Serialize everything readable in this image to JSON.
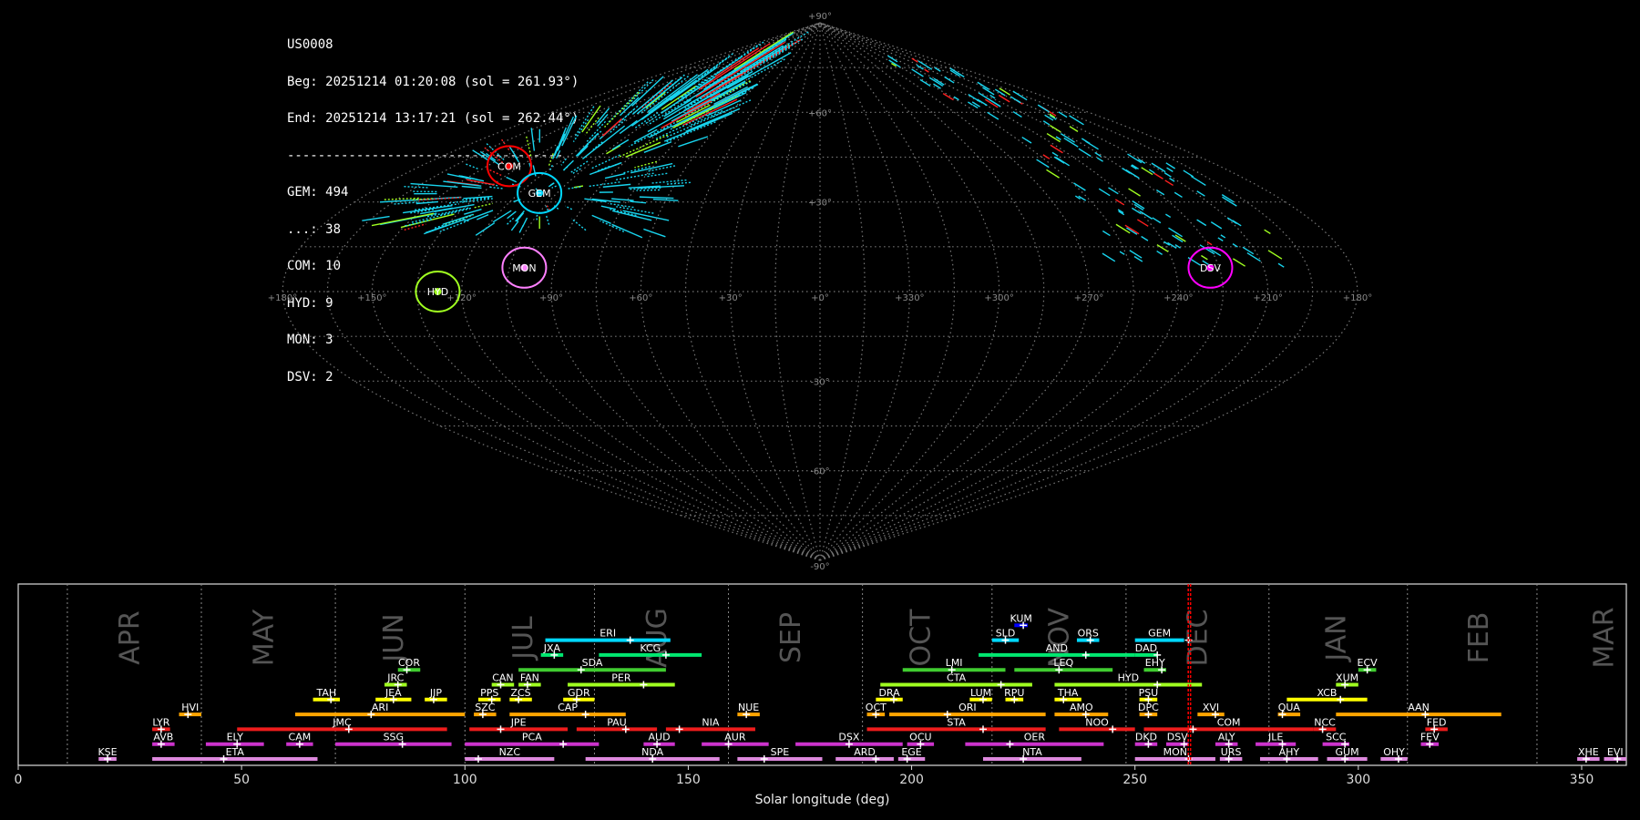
{
  "info": {
    "id": "US0008",
    "beg": "Beg: 20251214 01:20:08 (sol = 261.93°)",
    "end": "End: 20251214 13:17:21 (sol = 262.44°)",
    "sep": "------------------------------------",
    "counts": [
      "GEM: 494",
      "...: 38",
      "COM: 10",
      "HYD: 9",
      "MON: 3",
      "DSV: 2"
    ]
  },
  "sky_map": {
    "projection": "sinusoidal",
    "lat_labels": [
      "+90°",
      "+60°",
      "+30°",
      "-30°",
      "-60°",
      "-90°"
    ],
    "lon_labels": [
      "+180°",
      "+150°",
      "+120°",
      "+90°",
      "+60°",
      "+30°",
      "+0°",
      "+330°",
      "+300°",
      "+270°",
      "+240°",
      "+210°",
      "+180°"
    ],
    "radiants": [
      {
        "name": "COM",
        "lon": 140,
        "lat": 42,
        "color": "#ff0000"
      },
      {
        "name": "GEM",
        "lon": 112,
        "lat": 33,
        "color": "#00d8ff"
      },
      {
        "name": "MON",
        "lon": 100,
        "lat": 8,
        "color": "#ff80ff"
      },
      {
        "name": "HYD",
        "lon": 128,
        "lat": 0,
        "color": "#a0ff20"
      },
      {
        "name": "DSV",
        "lon": 228,
        "lat": 8,
        "color": "#ff00ff"
      }
    ]
  },
  "chart_data": {
    "type": "timeline",
    "xlabel": "Solar longitude (deg)",
    "xlim": [
      0,
      360
    ],
    "xticks": [
      0,
      50,
      100,
      150,
      200,
      250,
      300,
      350
    ],
    "month_boundaries": [
      11,
      41,
      71,
      100,
      129,
      159,
      189,
      218,
      248,
      280,
      311,
      340
    ],
    "months": [
      {
        "name": "APR",
        "x": 25
      },
      {
        "name": "MAY",
        "x": 55
      },
      {
        "name": "JUN",
        "x": 84
      },
      {
        "name": "JUL",
        "x": 113
      },
      {
        "name": "AUG",
        "x": 143
      },
      {
        "name": "SEP",
        "x": 173
      },
      {
        "name": "OCT",
        "x": 202
      },
      {
        "name": "NOV",
        "x": 233
      },
      {
        "name": "DEC",
        "x": 264
      },
      {
        "name": "JAN",
        "x": 295
      },
      {
        "name": "FEB",
        "x": 327
      },
      {
        "name": "MAR",
        "x": 355
      }
    ],
    "current_sol": [
      261.93,
      262.44
    ],
    "showers": [
      {
        "name": "KUM",
        "start": 223,
        "end": 226,
        "peak": 225,
        "row": 10,
        "color": "#0000ff"
      },
      {
        "name": "ERI",
        "start": 118,
        "end": 146,
        "peak": 137,
        "row": 9,
        "color": "#00d8ff"
      },
      {
        "name": "SLD",
        "start": 218,
        "end": 224,
        "peak": 221,
        "row": 9,
        "color": "#00d8ff"
      },
      {
        "name": "ORS",
        "start": 237,
        "end": 242,
        "peak": 240,
        "row": 9,
        "color": "#00d8ff"
      },
      {
        "name": "GEM",
        "start": 250,
        "end": 261,
        "peak": 262,
        "row": 9,
        "color": "#00d8ff"
      },
      {
        "name": "JXA",
        "start": 117,
        "end": 122,
        "peak": 120,
        "row": 8,
        "color": "#00e870"
      },
      {
        "name": "KCG",
        "start": 130,
        "end": 153,
        "peak": 145,
        "row": 8,
        "color": "#00e870"
      },
      {
        "name": "AND",
        "start": 215,
        "end": 250,
        "peak": 239,
        "row": 8,
        "color": "#00e870"
      },
      {
        "name": "DAD",
        "start": 250,
        "end": 255,
        "peak": 255,
        "row": 8,
        "color": "#00e870"
      },
      {
        "name": "COR",
        "start": 85,
        "end": 90,
        "peak": 87,
        "row": 7,
        "color": "#40cc30"
      },
      {
        "name": "SDA",
        "start": 112,
        "end": 145,
        "peak": 126,
        "row": 7,
        "color": "#40cc30"
      },
      {
        "name": "LMI",
        "start": 198,
        "end": 221,
        "peak": 209,
        "row": 7,
        "color": "#40cc30"
      },
      {
        "name": "LEQ",
        "start": 223,
        "end": 245,
        "peak": 233,
        "row": 7,
        "color": "#40cc30"
      },
      {
        "name": "EHY",
        "start": 252,
        "end": 257,
        "peak": 256,
        "row": 7,
        "color": "#40cc30"
      },
      {
        "name": "ECV",
        "start": 300,
        "end": 304,
        "peak": 302,
        "row": 7,
        "color": "#40cc30"
      },
      {
        "name": "JRC",
        "start": 82,
        "end": 87,
        "peak": 85,
        "row": 6,
        "color": "#a0ff20"
      },
      {
        "name": "CAN",
        "start": 106,
        "end": 111,
        "peak": 108,
        "row": 6,
        "color": "#a0ff20"
      },
      {
        "name": "FAN",
        "start": 112,
        "end": 117,
        "peak": 114,
        "row": 6,
        "color": "#a0ff20"
      },
      {
        "name": "PER",
        "start": 123,
        "end": 147,
        "peak": 140,
        "row": 6,
        "color": "#a0ff20"
      },
      {
        "name": "CTA",
        "start": 193,
        "end": 227,
        "peak": 220,
        "row": 6,
        "color": "#a0ff20"
      },
      {
        "name": "HYD",
        "start": 232,
        "end": 265,
        "peak": 255,
        "row": 6,
        "color": "#a0ff20"
      },
      {
        "name": "XUM",
        "start": 295,
        "end": 300,
        "peak": 297,
        "row": 6,
        "color": "#a0ff20"
      },
      {
        "name": "TAH",
        "start": 66,
        "end": 72,
        "peak": 70,
        "row": 5,
        "color": "#ffff00"
      },
      {
        "name": "JEA",
        "start": 80,
        "end": 88,
        "peak": 84,
        "row": 5,
        "color": "#ffff00"
      },
      {
        "name": "JIP",
        "start": 91,
        "end": 96,
        "peak": 93,
        "row": 5,
        "color": "#ffff00"
      },
      {
        "name": "PPS",
        "start": 103,
        "end": 108,
        "peak": 106,
        "row": 5,
        "color": "#ffff00"
      },
      {
        "name": "ZCS",
        "start": 110,
        "end": 115,
        "peak": 112,
        "row": 5,
        "color": "#ffff00"
      },
      {
        "name": "GDR",
        "start": 122,
        "end": 129,
        "peak": 125,
        "row": 5,
        "color": "#ffff00"
      },
      {
        "name": "DRA",
        "start": 192,
        "end": 198,
        "peak": 196,
        "row": 5,
        "color": "#ffff00"
      },
      {
        "name": "LUM",
        "start": 213,
        "end": 218,
        "peak": 216,
        "row": 5,
        "color": "#ffff00"
      },
      {
        "name": "RPU",
        "start": 221,
        "end": 225,
        "peak": 223,
        "row": 5,
        "color": "#ffff00"
      },
      {
        "name": "THA",
        "start": 232,
        "end": 238,
        "peak": 234,
        "row": 5,
        "color": "#ffff00"
      },
      {
        "name": "PSU",
        "start": 251,
        "end": 255,
        "peak": 253,
        "row": 5,
        "color": "#ffff00"
      },
      {
        "name": "XCB",
        "start": 284,
        "end": 302,
        "peak": 296,
        "row": 5,
        "color": "#ffff00"
      },
      {
        "name": "HVI",
        "start": 36,
        "end": 41,
        "peak": 38,
        "row": 4,
        "color": "#ffa500"
      },
      {
        "name": "ARI",
        "start": 62,
        "end": 100,
        "peak": 79,
        "row": 4,
        "color": "#ffa500"
      },
      {
        "name": "SZC",
        "start": 102,
        "end": 107,
        "peak": 104,
        "row": 4,
        "color": "#ffa500"
      },
      {
        "name": "CAP",
        "start": 110,
        "end": 136,
        "peak": 127,
        "row": 4,
        "color": "#ffa500"
      },
      {
        "name": "NUE",
        "start": 161,
        "end": 166,
        "peak": 163,
        "row": 4,
        "color": "#ffa500"
      },
      {
        "name": "OCT",
        "start": 190,
        "end": 194,
        "peak": 192,
        "row": 4,
        "color": "#ffa500"
      },
      {
        "name": "ORI",
        "start": 195,
        "end": 230,
        "peak": 208,
        "row": 4,
        "color": "#ffa500"
      },
      {
        "name": "AMO",
        "start": 232,
        "end": 244,
        "peak": 239,
        "row": 4,
        "color": "#ffa500"
      },
      {
        "name": "DPC",
        "start": 251,
        "end": 255,
        "peak": 253,
        "row": 4,
        "color": "#ffa500"
      },
      {
        "name": "XVI",
        "start": 264,
        "end": 270,
        "peak": 268,
        "row": 4,
        "color": "#ffa500"
      },
      {
        "name": "QUA",
        "start": 282,
        "end": 287,
        "peak": 283,
        "row": 4,
        "color": "#ffa500"
      },
      {
        "name": "AAN",
        "start": 295,
        "end": 332,
        "peak": 315,
        "row": 4,
        "color": "#ffa500"
      },
      {
        "name": "LYR",
        "start": 30,
        "end": 34,
        "peak": 32,
        "row": 3,
        "color": "#ee1c1c"
      },
      {
        "name": "JMC",
        "start": 49,
        "end": 96,
        "peak": 74,
        "row": 3,
        "color": "#ee1c1c"
      },
      {
        "name": "JPE",
        "start": 101,
        "end": 123,
        "peak": 108,
        "row": 3,
        "color": "#ee1c1c"
      },
      {
        "name": "PAU",
        "start": 125,
        "end": 143,
        "peak": 136,
        "row": 3,
        "color": "#ee1c1c"
      },
      {
        "name": "NIA",
        "start": 145,
        "end": 165,
        "peak": 148,
        "row": 3,
        "color": "#ee1c1c"
      },
      {
        "name": "STA",
        "start": 190,
        "end": 230,
        "peak": 216,
        "row": 3,
        "color": "#ee1c1c"
      },
      {
        "name": "NOO",
        "start": 233,
        "end": 250,
        "peak": 245,
        "row": 3,
        "color": "#ee1c1c"
      },
      {
        "name": "COM",
        "start": 252,
        "end": 290,
        "peak": 263,
        "row": 3,
        "color": "#ee1c1c"
      },
      {
        "name": "NCC",
        "start": 290,
        "end": 295,
        "peak": 292,
        "row": 3,
        "color": "#ee1c1c"
      },
      {
        "name": "FED",
        "start": 315,
        "end": 320,
        "peak": 317,
        "row": 3,
        "color": "#ee1c1c"
      },
      {
        "name": "AVB",
        "start": 30,
        "end": 35,
        "peak": 32,
        "row": 2,
        "color": "#cc33cc"
      },
      {
        "name": "ELY",
        "start": 42,
        "end": 55,
        "peak": 49,
        "row": 2,
        "color": "#cc33cc"
      },
      {
        "name": "CAM",
        "start": 60,
        "end": 66,
        "peak": 63,
        "row": 2,
        "color": "#cc33cc"
      },
      {
        "name": "SSG",
        "start": 71,
        "end": 97,
        "peak": 86,
        "row": 2,
        "color": "#cc33cc"
      },
      {
        "name": "PCA",
        "start": 100,
        "end": 130,
        "peak": 122,
        "row": 2,
        "color": "#cc33cc"
      },
      {
        "name": "AUD",
        "start": 140,
        "end": 147,
        "peak": 143,
        "row": 2,
        "color": "#cc33cc"
      },
      {
        "name": "AUR",
        "start": 153,
        "end": 168,
        "peak": 159,
        "row": 2,
        "color": "#cc33cc"
      },
      {
        "name": "DSX",
        "start": 174,
        "end": 198,
        "peak": 186,
        "row": 2,
        "color": "#cc33cc"
      },
      {
        "name": "OCU",
        "start": 199,
        "end": 205,
        "peak": 202,
        "row": 2,
        "color": "#cc33cc"
      },
      {
        "name": "OER",
        "start": 212,
        "end": 243,
        "peak": 222,
        "row": 2,
        "color": "#cc33cc"
      },
      {
        "name": "DKD",
        "start": 250,
        "end": 255,
        "peak": 253,
        "row": 2,
        "color": "#cc33cc"
      },
      {
        "name": "DSV",
        "start": 257,
        "end": 262,
        "peak": 261,
        "row": 2,
        "color": "#cc33cc"
      },
      {
        "name": "ALY",
        "start": 268,
        "end": 273,
        "peak": 271,
        "row": 2,
        "color": "#cc33cc"
      },
      {
        "name": "JLE",
        "start": 277,
        "end": 286,
        "peak": 283,
        "row": 2,
        "color": "#cc33cc"
      },
      {
        "name": "SCC",
        "start": 292,
        "end": 298,
        "peak": 297,
        "row": 2,
        "color": "#cc33cc"
      },
      {
        "name": "FEV",
        "start": 314,
        "end": 318,
        "peak": 316,
        "row": 2,
        "color": "#cc33cc"
      },
      {
        "name": "KSE",
        "start": 18,
        "end": 22,
        "peak": 20,
        "row": 1,
        "color": "#dd88dd"
      },
      {
        "name": "ETA",
        "start": 30,
        "end": 67,
        "peak": 46,
        "row": 1,
        "color": "#dd88dd"
      },
      {
        "name": "NZC",
        "start": 100,
        "end": 120,
        "peak": 103,
        "row": 1,
        "color": "#dd88dd"
      },
      {
        "name": "NDA",
        "start": 127,
        "end": 157,
        "peak": 142,
        "row": 1,
        "color": "#dd88dd"
      },
      {
        "name": "SPE",
        "start": 161,
        "end": 180,
        "peak": 167,
        "row": 1,
        "color": "#dd88dd"
      },
      {
        "name": "ARD",
        "start": 183,
        "end": 196,
        "peak": 192,
        "row": 1,
        "color": "#dd88dd"
      },
      {
        "name": "EGE",
        "start": 197,
        "end": 203,
        "peak": 199,
        "row": 1,
        "color": "#dd88dd"
      },
      {
        "name": "NTA",
        "start": 216,
        "end": 238,
        "peak": 225,
        "row": 1,
        "color": "#dd88dd"
      },
      {
        "name": "MON",
        "start": 250,
        "end": 268,
        "peak": 262,
        "row": 1,
        "color": "#dd88dd"
      },
      {
        "name": "URS",
        "start": 269,
        "end": 274,
        "peak": 271,
        "row": 1,
        "color": "#dd88dd"
      },
      {
        "name": "AHY",
        "start": 278,
        "end": 291,
        "peak": 284,
        "row": 1,
        "color": "#dd88dd"
      },
      {
        "name": "GUM",
        "start": 293,
        "end": 302,
        "peak": 297,
        "row": 1,
        "color": "#dd88dd"
      },
      {
        "name": "OHY",
        "start": 305,
        "end": 311,
        "peak": 309,
        "row": 1,
        "color": "#dd88dd"
      },
      {
        "name": "XHE",
        "start": 349,
        "end": 354,
        "peak": 351,
        "row": 1,
        "color": "#dd88dd"
      },
      {
        "name": "EVI",
        "start": 355,
        "end": 360,
        "peak": 358,
        "row": 1,
        "color": "#dd88dd"
      }
    ]
  }
}
